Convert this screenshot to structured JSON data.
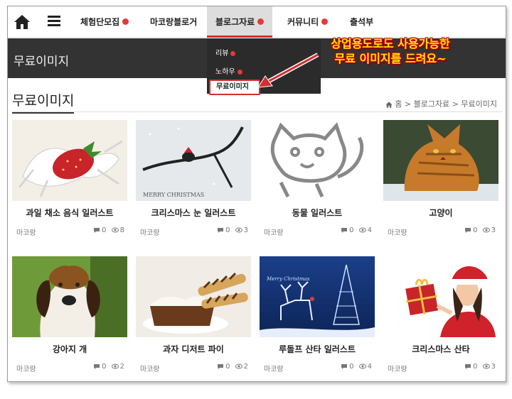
{
  "nav": {
    "items": [
      {
        "label": "체험단모집",
        "dot": true
      },
      {
        "label": "마코랑블로거",
        "dot": false
      },
      {
        "label": "블로그자료",
        "dot": true
      },
      {
        "label": "커뮤니티",
        "dot": true
      },
      {
        "label": "출석부",
        "dot": false
      }
    ]
  },
  "header": {
    "title": "무료이미지"
  },
  "dropdown": {
    "items": [
      {
        "label": "리뷰"
      },
      {
        "label": "노하우"
      }
    ],
    "selected": "무료이미지"
  },
  "callout": {
    "line1": "상업용도로도 사용가능한",
    "line2": "무료 이미지를 드려요~"
  },
  "section": {
    "title": "무료이미지",
    "breadcrumb": "홈 > 블로그자료 > 무료이미지"
  },
  "posts": [
    {
      "title": "과일 채소 음식 일러스트",
      "author": "마코랑",
      "comments": "0",
      "views": "8"
    },
    {
      "title": "크리스마스 눈 일러스트",
      "author": "마코랑",
      "comments": "0",
      "views": "3",
      "caption": "MERRY CHRISTMAS"
    },
    {
      "title": "동물 일러스트",
      "author": "마코랑",
      "comments": "0",
      "views": "4"
    },
    {
      "title": "고양이",
      "author": "마코랑",
      "comments": "0",
      "views": "3"
    },
    {
      "title": "강아지 개",
      "author": "마코랑",
      "comments": "0",
      "views": "2"
    },
    {
      "title": "과자 디저트 파이",
      "author": "마코랑",
      "comments": "0",
      "views": "2"
    },
    {
      "title": "루돌프 산타 일러스트",
      "author": "마코랑",
      "comments": "0",
      "views": "4",
      "caption": "Merry Christmas"
    },
    {
      "title": "크리스마스 산타",
      "author": "마코랑",
      "comments": "0",
      "views": "3"
    }
  ],
  "colors": {
    "accent": "#d32f2f",
    "band": "#333333",
    "callout": "#ffe600"
  }
}
